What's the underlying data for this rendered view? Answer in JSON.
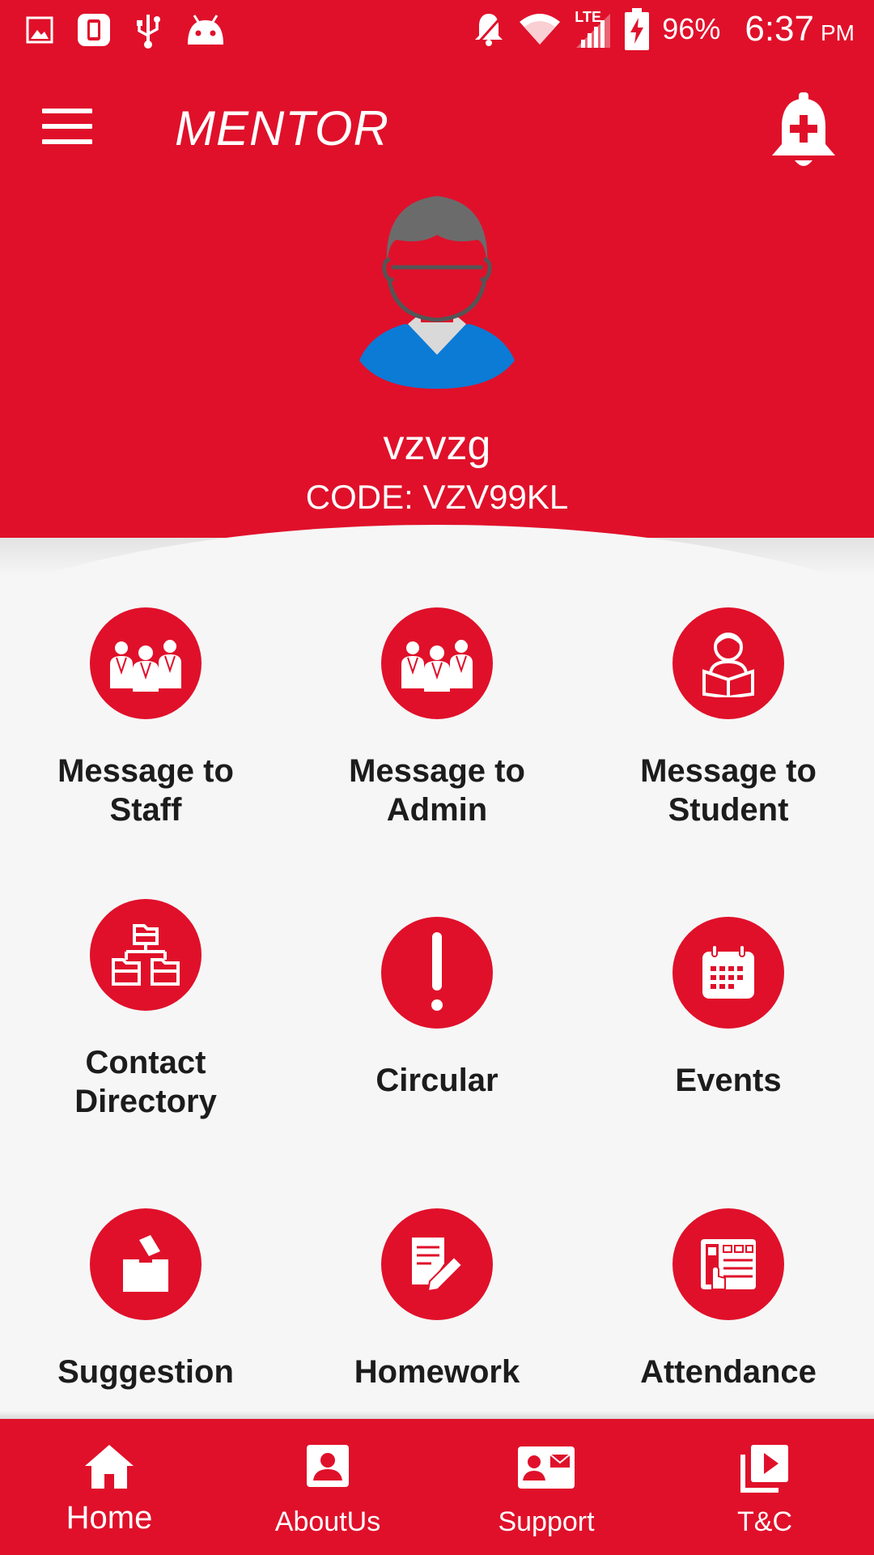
{
  "status_bar": {
    "battery": "96%",
    "time": "6:37",
    "ampm": "PM",
    "network": "LTE"
  },
  "app": {
    "title": "MENTOR"
  },
  "profile": {
    "name": "vzvzg",
    "code": "CODE: VZV99KL"
  },
  "grid": [
    {
      "label": "Message to\nStaff",
      "icon": "staff-group-icon"
    },
    {
      "label": "Message to\nAdmin",
      "icon": "admin-group-icon"
    },
    {
      "label": "Message to\nStudent",
      "icon": "student-reading-icon"
    },
    {
      "label": "Contact\nDirectory",
      "icon": "org-chart-icon"
    },
    {
      "label": "Circular",
      "icon": "exclamation-icon"
    },
    {
      "label": "Events",
      "icon": "calendar-icon"
    },
    {
      "label": "Suggestion",
      "icon": "ballot-box-icon"
    },
    {
      "label": "Homework",
      "icon": "notepad-pencil-icon"
    },
    {
      "label": "Attendance",
      "icon": "attendance-machine-icon"
    }
  ],
  "bottom_nav": [
    {
      "label": "Home",
      "icon": "home-icon"
    },
    {
      "label": "AboutUs",
      "icon": "person-card-icon"
    },
    {
      "label": "Support",
      "icon": "contact-mail-icon"
    },
    {
      "label": "T&C",
      "icon": "video-library-icon"
    }
  ],
  "colors": {
    "primary": "#e0102a",
    "background": "#f6f6f6",
    "label_text": "#1c1c1c",
    "avatar_shirt": "#0b7bd6",
    "avatar_hair": "#6b6b6b"
  }
}
